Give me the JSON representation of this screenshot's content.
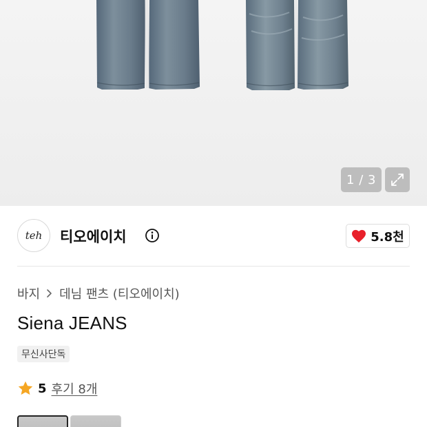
{
  "product_image": {
    "pager": "1 / 3",
    "icons": {
      "expand": "expand-icon"
    }
  },
  "brand": {
    "logo_text": "teh",
    "name": "티오에이치",
    "info_icon": "info-icon",
    "likes": "5.8천",
    "like_icon": "heart-icon",
    "like_color": "#e8202a"
  },
  "breadcrumb": {
    "category": "바지",
    "separator_icon": "chevron-right-icon",
    "subcategory": "데님 팬츠 (티오에이치)"
  },
  "product": {
    "title": "Siena JEANS",
    "badge": "무신사단독"
  },
  "rating": {
    "star_icon": "star-icon",
    "star_color": "#f5a623",
    "value": "5",
    "reviews": "후기 8개"
  },
  "options": [
    {
      "name": "option-thumb-1",
      "selected": true
    },
    {
      "name": "option-thumb-2",
      "selected": false
    }
  ]
}
